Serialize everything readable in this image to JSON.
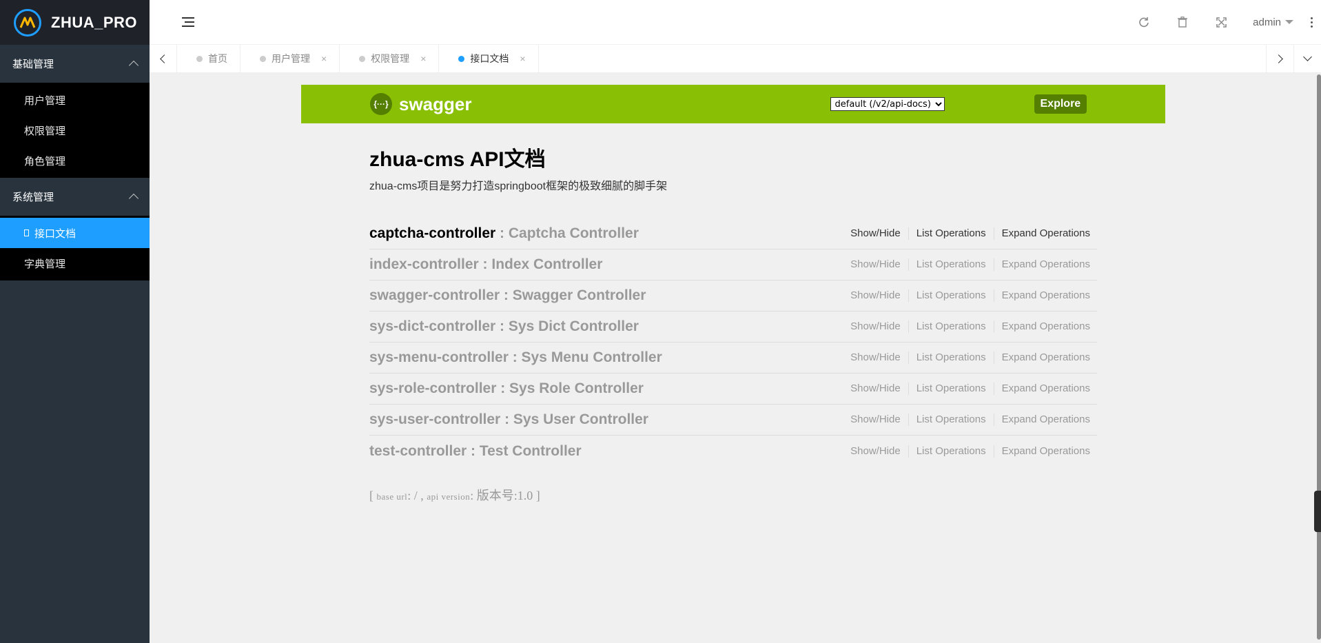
{
  "app": {
    "brand": "ZHUA_PRO",
    "user": "admin"
  },
  "sidebar": {
    "groups": [
      {
        "label": "基础管理",
        "items": [
          {
            "label": "用户管理"
          },
          {
            "label": "权限管理"
          },
          {
            "label": "角色管理"
          }
        ]
      },
      {
        "label": "系统管理",
        "items": [
          {
            "label": "接口文档",
            "active": true
          },
          {
            "label": "字典管理"
          }
        ]
      }
    ]
  },
  "tabs": [
    {
      "label": "首页",
      "closable": false,
      "active": false
    },
    {
      "label": "用户管理",
      "closable": true,
      "active": false
    },
    {
      "label": "权限管理",
      "closable": true,
      "active": false
    },
    {
      "label": "接口文档",
      "closable": true,
      "active": true
    }
  ],
  "tab_close_glyph": "×",
  "swagger": {
    "logo_glyph": "{···}",
    "title": "swagger",
    "spec_select": "default (/v2/api-docs)",
    "explore_label": "Explore"
  },
  "api": {
    "title": "zhua-cms API文档",
    "description": "zhua-cms项目是努力打造springboot框架的极致细腻的脚手架",
    "ops": {
      "show_hide": "Show/Hide",
      "list": "List Operations",
      "expand": "Expand Operations"
    },
    "resources": [
      {
        "name": "captcha-controller",
        "desc": " : Captcha Controller"
      },
      {
        "name": "index-controller",
        "desc": " : Index Controller"
      },
      {
        "name": "swagger-controller",
        "desc": " : Swagger Controller"
      },
      {
        "name": "sys-dict-controller",
        "desc": " : Sys Dict Controller"
      },
      {
        "name": "sys-menu-controller",
        "desc": " : Sys Menu Controller"
      },
      {
        "name": "sys-role-controller",
        "desc": " : Sys Role Controller"
      },
      {
        "name": "sys-user-controller",
        "desc": " : Sys User Controller"
      },
      {
        "name": "test-controller",
        "desc": " : Test Controller"
      }
    ],
    "footer": {
      "open": "[ ",
      "base_label": "base url",
      "base_value": ": / , ",
      "version_label": "api version",
      "version_value": ": 版本号:1.0 ]"
    }
  },
  "colors": {
    "swagger_green": "#89bf04",
    "accent_blue": "#1e9fff",
    "sidebar_bg": "#28333e"
  },
  "icons": [
    "refresh-icon",
    "trash-icon",
    "fullscreen-icon",
    "more-vertical-icon",
    "menu-toggle-icon"
  ]
}
